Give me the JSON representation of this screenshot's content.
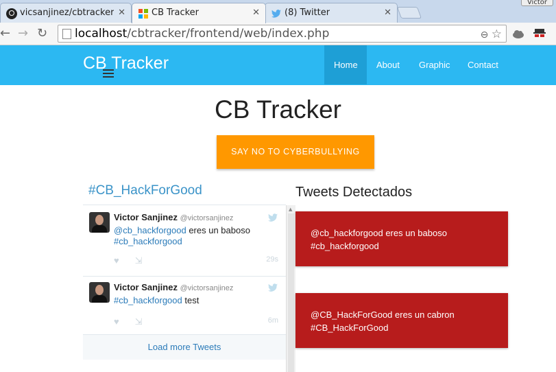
{
  "browser": {
    "tabs": [
      {
        "title": "vicsanjinez/cbtracker",
        "icon": "github-icon"
      },
      {
        "title": "CB Tracker",
        "icon": "windows-logo-icon"
      },
      {
        "title": "(8) Twitter",
        "icon": "twitter-icon"
      }
    ],
    "profile_name": "Victor",
    "url_host": "localhost",
    "url_path": "/cbtracker/frontend/web/index.php"
  },
  "navbar": {
    "brand": "CB Tracker",
    "items": [
      "Home",
      "About",
      "Graphic",
      "Contact"
    ],
    "active": "Home",
    "color": "#2cb8f2"
  },
  "hero": {
    "title": "CB Tracker",
    "cta_label": "SAY NO TO CYBERBULLYING",
    "cta_color": "#ff9800"
  },
  "widget": {
    "title": "#CB_HackForGood",
    "tweets": [
      {
        "name": "Victor Sanjinez",
        "handle": "@victorsanjinez",
        "mention": "@cb_hackforgood",
        "text_mid": " eres un baboso",
        "hashtag": "#cb_hackforgood",
        "text_end": "",
        "time": "29s"
      },
      {
        "name": "Victor Sanjinez",
        "handle": "@victorsanjinez",
        "mention": "",
        "text_mid": "",
        "hashtag": "#cb_hackforgood",
        "text_end": " test",
        "time": "6m"
      }
    ],
    "load_more": "Load more Tweets"
  },
  "detected": {
    "title": "Tweets Detectados",
    "cards": [
      {
        "line1": "@cb_hackforgood eres un baboso",
        "line2": "#cb_hackforgood"
      },
      {
        "line1": "@CB_HackForGood eres un cabron",
        "line2": "#CB_HackForGood"
      }
    ],
    "card_color": "#b71c1c"
  }
}
